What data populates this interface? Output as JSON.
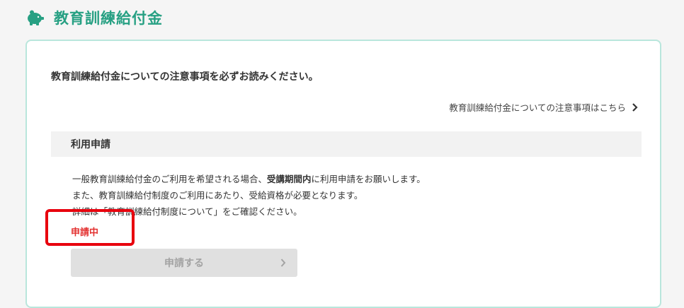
{
  "header": {
    "title": "教育訓練給付金",
    "icon": "piggy-bank-icon"
  },
  "notice": {
    "title": "教育訓練給付金についての注意事項を必ずお読みください。",
    "link_label": "教育訓練給付金についての注意事項はこちら"
  },
  "section": {
    "title": "利用申請",
    "line1_before": "一般教育訓練給付金のご利用を希望される場合、",
    "line1_bold": "受講期間内",
    "line1_after": "に利用申請をお願いします。",
    "line2": "また、教育訓練給付制度のご利用にあたり、受給資格が必要となります。",
    "line3": "詳細は「教育訓練給付制度について」をご確認ください。",
    "status": "申請中",
    "apply_label": "申請する"
  },
  "colors": {
    "accent": "#27a083",
    "card_border": "#b9e6dc",
    "status": "#e3302f",
    "highlight_box": "#e8000d",
    "disabled_button": "#e0e0e0"
  }
}
